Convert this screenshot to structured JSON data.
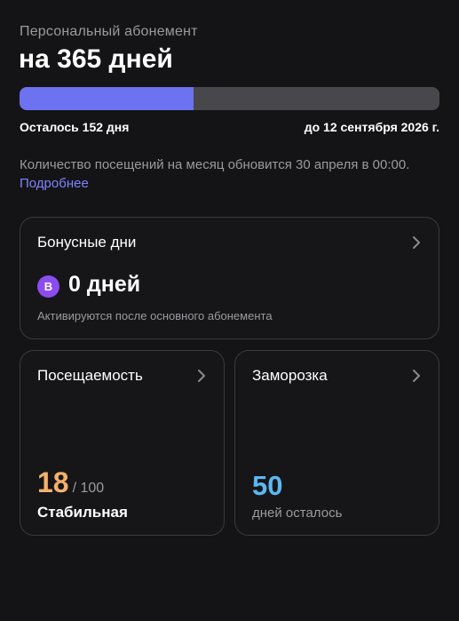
{
  "subscription": {
    "kind": "Персональный абонемент",
    "title": "на 365 дней",
    "progress_fraction": 0.415,
    "remaining": "Осталось 152 дня",
    "end_date": "до 12 сентября 2026 г."
  },
  "info": {
    "text": "Количество посещений на месяц обновится 30 апреля в 00:00. ",
    "link_label": "Подробнее"
  },
  "bonus_card": {
    "title": "Бонусные дни",
    "badge_letter": "B",
    "value": "0 дней",
    "caption": "Активируются после основного абонемента"
  },
  "visits_card": {
    "title": "Посещаемость",
    "count": "18",
    "limit": "/ 100",
    "status": "Стабильная"
  },
  "freeze_card": {
    "title": "Заморозка",
    "value": "50",
    "caption": "дней осталось"
  },
  "colors": {
    "background": "#141416",
    "progress_fill": "#6d72f0",
    "progress_track": "#48484c",
    "link": "#7f84ff",
    "bonus_badge": "#8b4cf0",
    "visits_count": "#f4b06c",
    "freeze_value": "#5bb8f0"
  },
  "icons": {
    "card_arrow": "chevron-right-icon",
    "bonus_badge": "bonus-b-icon"
  }
}
